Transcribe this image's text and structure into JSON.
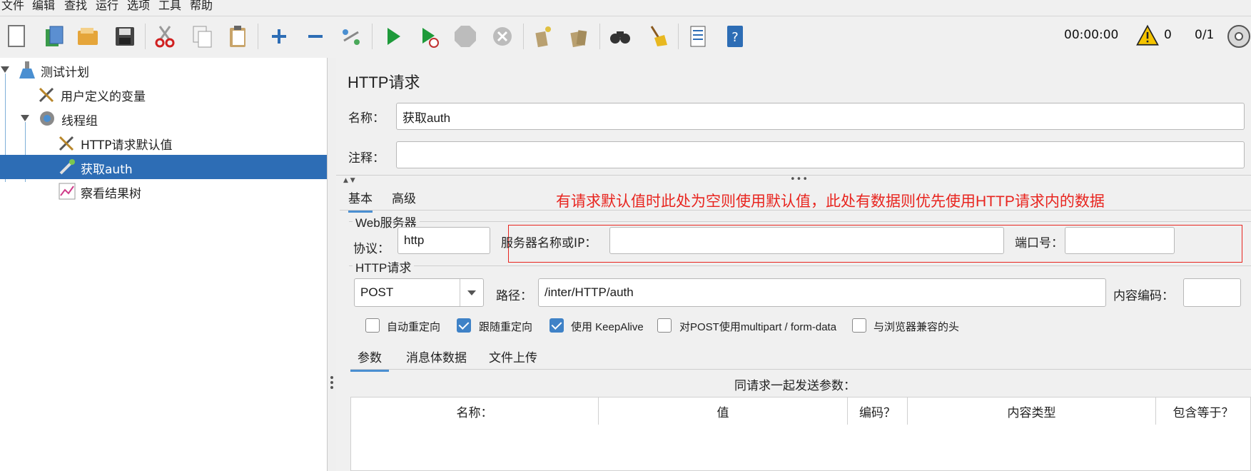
{
  "menu": [
    "文件",
    "编辑",
    "查找",
    "运行",
    "选项",
    "工具",
    "帮助"
  ],
  "toolbar": {
    "timer": "00:00:00",
    "warnings": "0",
    "threads": "0/1",
    "icons": [
      "new-icon",
      "templates-icon",
      "open-icon",
      "save-icon",
      "cut-icon",
      "copy-icon",
      "paste-icon",
      "expand-icon",
      "collapse-icon",
      "toggle-icon",
      "start-icon",
      "start-no-pause-icon",
      "stop-icon",
      "shutdown-icon",
      "clear-icon",
      "clear-all-icon",
      "search-icon",
      "reset-search-icon",
      "function-helper-icon",
      "help-icon"
    ]
  },
  "tree": {
    "items": [
      {
        "label": "测试计划"
      },
      {
        "label": "用户定义的变量"
      },
      {
        "label": "线程组"
      },
      {
        "label": "HTTP请求默认值"
      },
      {
        "label": "获取auth"
      },
      {
        "label": "察看结果树"
      }
    ]
  },
  "panel": {
    "title": "HTTP请求",
    "name_label": "名称：",
    "name_value": "获取auth",
    "comment_label": "注释：",
    "comment_value": "",
    "tabs": [
      "基本",
      "高级"
    ],
    "annotation": "有请求默认值时此处为空则使用默认值，此处有数据则优先使用HTTP请求内的数据",
    "web_server": {
      "header": "Web服务器",
      "protocol_label": "协议：",
      "protocol_value": "http",
      "server_label": "服务器名称或IP：",
      "server_value": "",
      "port_label": "端口号：",
      "port_value": ""
    },
    "http_request": {
      "header": "HTTP请求",
      "method": "POST",
      "path_label": "路径：",
      "path_value": "/inter/HTTP/auth",
      "encoding_label": "内容编码：",
      "encoding_value": ""
    },
    "checkboxes": [
      {
        "label": "自动重定向",
        "checked": false
      },
      {
        "label": "跟随重定向",
        "checked": true
      },
      {
        "label": "使用 KeepAlive",
        "checked": true
      },
      {
        "label": "对POST使用multipart / form-data",
        "checked": false
      },
      {
        "label": "与浏览器兼容的头",
        "checked": false
      }
    ],
    "sub_tabs": [
      "参数",
      "消息体数据",
      "文件上传"
    ],
    "params_caption": "同请求一起发送参数：",
    "table_headers": [
      "名称：",
      "值",
      "编码？",
      "内容类型",
      "包含等于？"
    ]
  },
  "colors": {
    "selection": "#2d6db5",
    "annotation": "#e8251f",
    "tab_accent": "#4a8fd1"
  }
}
